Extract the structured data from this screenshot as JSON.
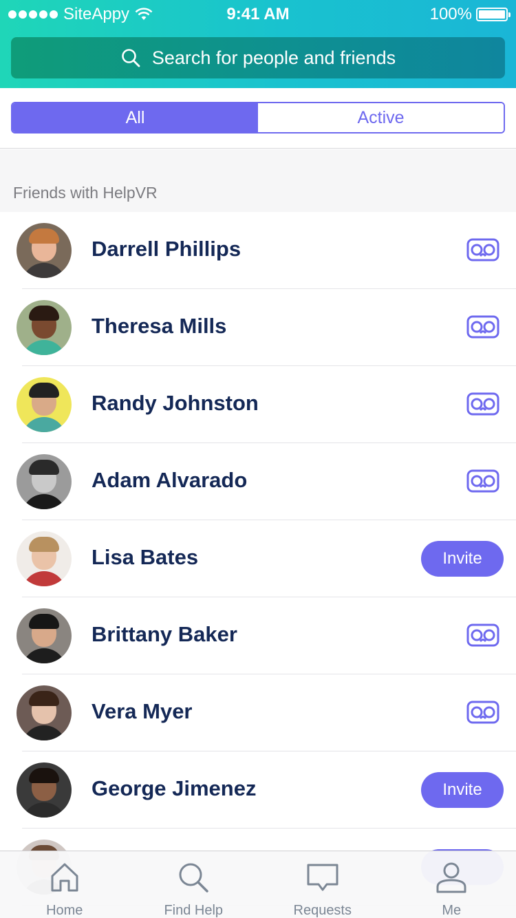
{
  "status": {
    "carrier": "SiteAppy",
    "time": "9:41 AM",
    "battery": "100%"
  },
  "search": {
    "placeholder": "Search for people and friends"
  },
  "segments": {
    "all": "All",
    "active": "Active",
    "selected": "All"
  },
  "section": {
    "title": "Friends with HelpVR"
  },
  "friends": [
    {
      "name": "Darrell Phillips",
      "action": "vr",
      "skin": "#e9b699",
      "hair": "#c4793f",
      "bg": "#7a6a5a",
      "shirt": "#3d3a3a"
    },
    {
      "name": "Theresa Mills",
      "action": "vr",
      "skin": "#7a4a30",
      "hair": "#2a1a12",
      "bg": "#9fb08a",
      "shirt": "#3fb39a"
    },
    {
      "name": "Randy Johnston",
      "action": "vr",
      "skin": "#d9aa88",
      "hair": "#222",
      "bg": "#efe65a",
      "shirt": "#4aa9a0"
    },
    {
      "name": "Adam Alvarado",
      "action": "vr",
      "skin": "#c9c9c9",
      "hair": "#2a2a2a",
      "bg": "#9b9b9b",
      "shirt": "#1a1a1a"
    },
    {
      "name": "Lisa Bates",
      "action": "invite",
      "invite_label": "Invite",
      "skin": "#eac3a8",
      "hair": "#b89160",
      "bg": "#f0ece8",
      "shirt": "#c13a3a"
    },
    {
      "name": "Brittany Baker",
      "action": "vr",
      "skin": "#d8a98a",
      "hair": "#161616",
      "bg": "#8a8580",
      "shirt": "#1d1d1d"
    },
    {
      "name": "Vera Myer",
      "action": "vr",
      "skin": "#e5c2ac",
      "hair": "#3a2418",
      "bg": "#6d5b55",
      "shirt": "#222"
    },
    {
      "name": "George Jimenez",
      "action": "invite",
      "invite_label": "Invite",
      "skin": "#8c5f45",
      "hair": "#1a120e",
      "bg": "#3a3a3a",
      "shirt": "#2b2b2b"
    },
    {
      "name": "",
      "action": "invite",
      "invite_label": "",
      "skin": "#d9b49a",
      "hair": "#6b4a35",
      "bg": "#cfc6c2",
      "shirt": "#5a5a5a"
    }
  ],
  "tabs": [
    {
      "id": "home",
      "label": "Home",
      "icon": "home-icon"
    },
    {
      "id": "find-help",
      "label": "Find Help",
      "icon": "search-icon"
    },
    {
      "id": "requests",
      "label": "Requests",
      "icon": "chat-bubble-icon"
    },
    {
      "id": "me",
      "label": "Me",
      "icon": "person-icon"
    }
  ],
  "colors": {
    "accent": "#6e69ef",
    "name": "#142856",
    "tabGray": "#7b8694"
  }
}
